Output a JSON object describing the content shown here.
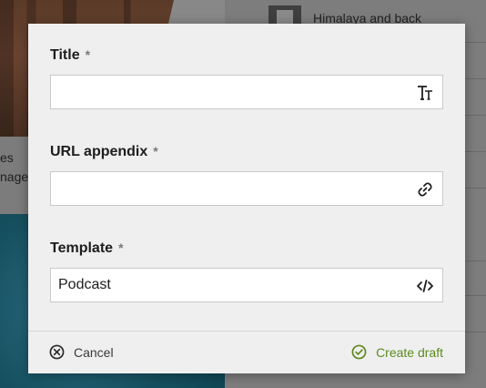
{
  "background": {
    "caption_line1": "es",
    "caption_line2": "nage(",
    "list_item_title": "Himalaya and back"
  },
  "dialog": {
    "fields": [
      {
        "label": "Title",
        "required_mark": "*",
        "value": "",
        "icon": "text-size-icon"
      },
      {
        "label": "URL appendix",
        "required_mark": "*",
        "value": "",
        "icon": "link-icon"
      },
      {
        "label": "Template",
        "required_mark": "*",
        "value": "Podcast",
        "icon": "code-icon"
      }
    ],
    "cancel_label": "Cancel",
    "create_label": "Create draft"
  },
  "colors": {
    "accent_green": "#5e8a1f",
    "dialog_bg": "#efefef"
  }
}
